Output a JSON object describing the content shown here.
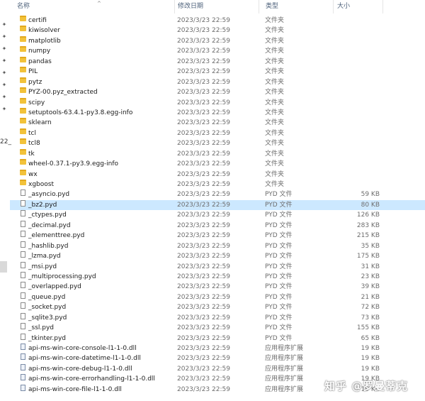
{
  "header": {
    "name": "名称",
    "date": "修改日期",
    "type": "类型",
    "size": "大小",
    "sort_arrow": "^"
  },
  "side": {
    "text": "22_"
  },
  "watermark": "知乎 @罗曼蒂克",
  "files": [
    {
      "name": "certifi",
      "date": "2023/3/23 22:59",
      "type": "文件夹",
      "size": "",
      "icon": "folder-icon"
    },
    {
      "name": "kiwisolver",
      "date": "2023/3/23 22:59",
      "type": "文件夹",
      "size": "",
      "icon": "folder-icon"
    },
    {
      "name": "matplotlib",
      "date": "2023/3/23 22:59",
      "type": "文件夹",
      "size": "",
      "icon": "folder-icon"
    },
    {
      "name": "numpy",
      "date": "2023/3/23 22:59",
      "type": "文件夹",
      "size": "",
      "icon": "folder-icon"
    },
    {
      "name": "pandas",
      "date": "2023/3/23 22:59",
      "type": "文件夹",
      "size": "",
      "icon": "folder-icon"
    },
    {
      "name": "PIL",
      "date": "2023/3/23 22:59",
      "type": "文件夹",
      "size": "",
      "icon": "folder-icon"
    },
    {
      "name": "pytz",
      "date": "2023/3/23 22:59",
      "type": "文件夹",
      "size": "",
      "icon": "folder-icon"
    },
    {
      "name": "PYZ-00.pyz_extracted",
      "date": "2023/3/23 22:59",
      "type": "文件夹",
      "size": "",
      "icon": "folder-icon"
    },
    {
      "name": "scipy",
      "date": "2023/3/23 22:59",
      "type": "文件夹",
      "size": "",
      "icon": "folder-icon"
    },
    {
      "name": "setuptools-63.4.1-py3.8.egg-info",
      "date": "2023/3/23 22:59",
      "type": "文件夹",
      "size": "",
      "icon": "folder-icon"
    },
    {
      "name": "sklearn",
      "date": "2023/3/23 22:59",
      "type": "文件夹",
      "size": "",
      "icon": "folder-icon"
    },
    {
      "name": "tcl",
      "date": "2023/3/23 22:59",
      "type": "文件夹",
      "size": "",
      "icon": "folder-icon"
    },
    {
      "name": "tcl8",
      "date": "2023/3/23 22:59",
      "type": "文件夹",
      "size": "",
      "icon": "folder-icon"
    },
    {
      "name": "tk",
      "date": "2023/3/23 22:59",
      "type": "文件夹",
      "size": "",
      "icon": "folder-icon"
    },
    {
      "name": "wheel-0.37.1-py3.9.egg-info",
      "date": "2023/3/23 22:59",
      "type": "文件夹",
      "size": "",
      "icon": "folder-icon"
    },
    {
      "name": "wx",
      "date": "2023/3/23 22:59",
      "type": "文件夹",
      "size": "",
      "icon": "folder-icon"
    },
    {
      "name": "xgboost",
      "date": "2023/3/23 22:59",
      "type": "文件夹",
      "size": "",
      "icon": "folder-icon"
    },
    {
      "name": "_asyncio.pyd",
      "date": "2023/3/23 22:59",
      "type": "PYD 文件",
      "size": "59 KB",
      "icon": "file-icon"
    },
    {
      "name": "_bz2.pyd",
      "date": "2023/3/23 22:59",
      "type": "PYD 文件",
      "size": "80 KB",
      "icon": "file-icon",
      "selected": true
    },
    {
      "name": "_ctypes.pyd",
      "date": "2023/3/23 22:59",
      "type": "PYD 文件",
      "size": "126 KB",
      "icon": "file-icon"
    },
    {
      "name": "_decimal.pyd",
      "date": "2023/3/23 22:59",
      "type": "PYD 文件",
      "size": "283 KB",
      "icon": "file-icon"
    },
    {
      "name": "_elementtree.pyd",
      "date": "2023/3/23 22:59",
      "type": "PYD 文件",
      "size": "215 KB",
      "icon": "file-icon"
    },
    {
      "name": "_hashlib.pyd",
      "date": "2023/3/23 22:59",
      "type": "PYD 文件",
      "size": "35 KB",
      "icon": "file-icon"
    },
    {
      "name": "_lzma.pyd",
      "date": "2023/3/23 22:59",
      "type": "PYD 文件",
      "size": "175 KB",
      "icon": "file-icon"
    },
    {
      "name": "_msi.pyd",
      "date": "2023/3/23 22:59",
      "type": "PYD 文件",
      "size": "31 KB",
      "icon": "file-icon"
    },
    {
      "name": "_multiprocessing.pyd",
      "date": "2023/3/23 22:59",
      "type": "PYD 文件",
      "size": "23 KB",
      "icon": "file-icon"
    },
    {
      "name": "_overlapped.pyd",
      "date": "2023/3/23 22:59",
      "type": "PYD 文件",
      "size": "39 KB",
      "icon": "file-icon"
    },
    {
      "name": "_queue.pyd",
      "date": "2023/3/23 22:59",
      "type": "PYD 文件",
      "size": "21 KB",
      "icon": "file-icon"
    },
    {
      "name": "_socket.pyd",
      "date": "2023/3/23 22:59",
      "type": "PYD 文件",
      "size": "72 KB",
      "icon": "file-icon"
    },
    {
      "name": "_sqlite3.pyd",
      "date": "2023/3/23 22:59",
      "type": "PYD 文件",
      "size": "73 KB",
      "icon": "file-icon"
    },
    {
      "name": "_ssl.pyd",
      "date": "2023/3/23 22:59",
      "type": "PYD 文件",
      "size": "155 KB",
      "icon": "file-icon"
    },
    {
      "name": "_tkinter.pyd",
      "date": "2023/3/23 22:59",
      "type": "PYD 文件",
      "size": "65 KB",
      "icon": "file-icon"
    },
    {
      "name": "api-ms-win-core-console-l1-1-0.dll",
      "date": "2023/3/23 22:59",
      "type": "应用程序扩展",
      "size": "19 KB",
      "icon": "dll-icon"
    },
    {
      "name": "api-ms-win-core-datetime-l1-1-0.dll",
      "date": "2023/3/23 22:59",
      "type": "应用程序扩展",
      "size": "19 KB",
      "icon": "dll-icon"
    },
    {
      "name": "api-ms-win-core-debug-l1-1-0.dll",
      "date": "2023/3/23 22:59",
      "type": "应用程序扩展",
      "size": "19 KB",
      "icon": "dll-icon"
    },
    {
      "name": "api-ms-win-core-errorhandling-l1-1-0.dll",
      "date": "2023/3/23 22:59",
      "type": "应用程序扩展",
      "size": "19 KB",
      "icon": "dll-icon"
    },
    {
      "name": "api-ms-win-core-file-l1-1-0.dll",
      "date": "2023/3/23 22:59",
      "type": "应用程序扩展",
      "size": "19 KB",
      "icon": "dll-icon"
    }
  ]
}
